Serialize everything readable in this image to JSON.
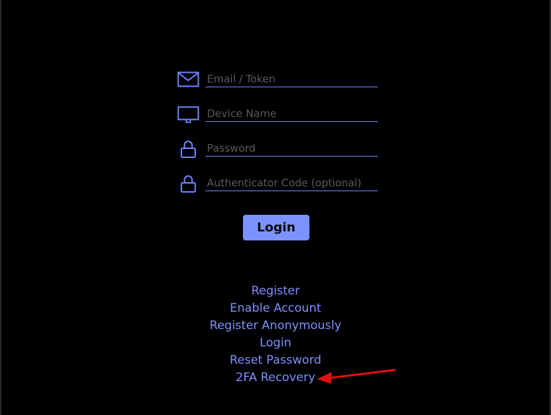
{
  "form": {
    "fields": [
      {
        "icon": "envelope-icon",
        "placeholder": "Email / Token",
        "value": ""
      },
      {
        "icon": "monitor-icon",
        "placeholder": "Device Name",
        "value": ""
      },
      {
        "icon": "lock-icon",
        "placeholder": "Password",
        "value": ""
      },
      {
        "icon": "lock-icon",
        "placeholder": "Authenticator Code (optional)",
        "value": ""
      }
    ],
    "login_button": "Login"
  },
  "links": [
    "Register",
    "Enable Account",
    "Register Anonymously",
    "Login",
    "Reset Password",
    "2FA Recovery"
  ],
  "colors": {
    "background": "#000000",
    "accent": "#7b93ff",
    "link": "#7f91ff",
    "placeholder": "#5a5a5a",
    "annotation_arrow": "#e01010"
  }
}
